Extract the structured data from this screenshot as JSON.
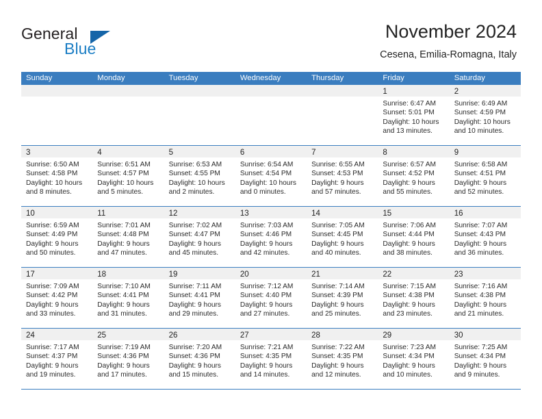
{
  "brand": {
    "name_part1": "General",
    "name_part2": "Blue",
    "flag_color": "#1565a8",
    "blue_color": "#1a7dc4"
  },
  "header": {
    "title": "November 2024",
    "location": "Cesena, Emilia-Romagna, Italy"
  },
  "theme": {
    "header_blue": "#3a7dbf",
    "day_band_gray": "#f0f0f0",
    "text": "#222222"
  },
  "weekdays": [
    "Sunday",
    "Monday",
    "Tuesday",
    "Wednesday",
    "Thursday",
    "Friday",
    "Saturday"
  ],
  "weeks": [
    [
      {
        "day": "",
        "sunrise": "",
        "sunset": "",
        "daylight_line1": "",
        "daylight_line2": "",
        "empty": true
      },
      {
        "day": "",
        "sunrise": "",
        "sunset": "",
        "daylight_line1": "",
        "daylight_line2": "",
        "empty": true
      },
      {
        "day": "",
        "sunrise": "",
        "sunset": "",
        "daylight_line1": "",
        "daylight_line2": "",
        "empty": true
      },
      {
        "day": "",
        "sunrise": "",
        "sunset": "",
        "daylight_line1": "",
        "daylight_line2": "",
        "empty": true
      },
      {
        "day": "",
        "sunrise": "",
        "sunset": "",
        "daylight_line1": "",
        "daylight_line2": "",
        "empty": true
      },
      {
        "day": "1",
        "sunrise": "Sunrise: 6:47 AM",
        "sunset": "Sunset: 5:01 PM",
        "daylight_line1": "Daylight: 10 hours",
        "daylight_line2": "and 13 minutes."
      },
      {
        "day": "2",
        "sunrise": "Sunrise: 6:49 AM",
        "sunset": "Sunset: 4:59 PM",
        "daylight_line1": "Daylight: 10 hours",
        "daylight_line2": "and 10 minutes."
      }
    ],
    [
      {
        "day": "3",
        "sunrise": "Sunrise: 6:50 AM",
        "sunset": "Sunset: 4:58 PM",
        "daylight_line1": "Daylight: 10 hours",
        "daylight_line2": "and 8 minutes."
      },
      {
        "day": "4",
        "sunrise": "Sunrise: 6:51 AM",
        "sunset": "Sunset: 4:57 PM",
        "daylight_line1": "Daylight: 10 hours",
        "daylight_line2": "and 5 minutes."
      },
      {
        "day": "5",
        "sunrise": "Sunrise: 6:53 AM",
        "sunset": "Sunset: 4:55 PM",
        "daylight_line1": "Daylight: 10 hours",
        "daylight_line2": "and 2 minutes."
      },
      {
        "day": "6",
        "sunrise": "Sunrise: 6:54 AM",
        "sunset": "Sunset: 4:54 PM",
        "daylight_line1": "Daylight: 10 hours",
        "daylight_line2": "and 0 minutes."
      },
      {
        "day": "7",
        "sunrise": "Sunrise: 6:55 AM",
        "sunset": "Sunset: 4:53 PM",
        "daylight_line1": "Daylight: 9 hours",
        "daylight_line2": "and 57 minutes."
      },
      {
        "day": "8",
        "sunrise": "Sunrise: 6:57 AM",
        "sunset": "Sunset: 4:52 PM",
        "daylight_line1": "Daylight: 9 hours",
        "daylight_line2": "and 55 minutes."
      },
      {
        "day": "9",
        "sunrise": "Sunrise: 6:58 AM",
        "sunset": "Sunset: 4:51 PM",
        "daylight_line1": "Daylight: 9 hours",
        "daylight_line2": "and 52 minutes."
      }
    ],
    [
      {
        "day": "10",
        "sunrise": "Sunrise: 6:59 AM",
        "sunset": "Sunset: 4:49 PM",
        "daylight_line1": "Daylight: 9 hours",
        "daylight_line2": "and 50 minutes."
      },
      {
        "day": "11",
        "sunrise": "Sunrise: 7:01 AM",
        "sunset": "Sunset: 4:48 PM",
        "daylight_line1": "Daylight: 9 hours",
        "daylight_line2": "and 47 minutes."
      },
      {
        "day": "12",
        "sunrise": "Sunrise: 7:02 AM",
        "sunset": "Sunset: 4:47 PM",
        "daylight_line1": "Daylight: 9 hours",
        "daylight_line2": "and 45 minutes."
      },
      {
        "day": "13",
        "sunrise": "Sunrise: 7:03 AM",
        "sunset": "Sunset: 4:46 PM",
        "daylight_line1": "Daylight: 9 hours",
        "daylight_line2": "and 42 minutes."
      },
      {
        "day": "14",
        "sunrise": "Sunrise: 7:05 AM",
        "sunset": "Sunset: 4:45 PM",
        "daylight_line1": "Daylight: 9 hours",
        "daylight_line2": "and 40 minutes."
      },
      {
        "day": "15",
        "sunrise": "Sunrise: 7:06 AM",
        "sunset": "Sunset: 4:44 PM",
        "daylight_line1": "Daylight: 9 hours",
        "daylight_line2": "and 38 minutes."
      },
      {
        "day": "16",
        "sunrise": "Sunrise: 7:07 AM",
        "sunset": "Sunset: 4:43 PM",
        "daylight_line1": "Daylight: 9 hours",
        "daylight_line2": "and 36 minutes."
      }
    ],
    [
      {
        "day": "17",
        "sunrise": "Sunrise: 7:09 AM",
        "sunset": "Sunset: 4:42 PM",
        "daylight_line1": "Daylight: 9 hours",
        "daylight_line2": "and 33 minutes."
      },
      {
        "day": "18",
        "sunrise": "Sunrise: 7:10 AM",
        "sunset": "Sunset: 4:41 PM",
        "daylight_line1": "Daylight: 9 hours",
        "daylight_line2": "and 31 minutes."
      },
      {
        "day": "19",
        "sunrise": "Sunrise: 7:11 AM",
        "sunset": "Sunset: 4:41 PM",
        "daylight_line1": "Daylight: 9 hours",
        "daylight_line2": "and 29 minutes."
      },
      {
        "day": "20",
        "sunrise": "Sunrise: 7:12 AM",
        "sunset": "Sunset: 4:40 PM",
        "daylight_line1": "Daylight: 9 hours",
        "daylight_line2": "and 27 minutes."
      },
      {
        "day": "21",
        "sunrise": "Sunrise: 7:14 AM",
        "sunset": "Sunset: 4:39 PM",
        "daylight_line1": "Daylight: 9 hours",
        "daylight_line2": "and 25 minutes."
      },
      {
        "day": "22",
        "sunrise": "Sunrise: 7:15 AM",
        "sunset": "Sunset: 4:38 PM",
        "daylight_line1": "Daylight: 9 hours",
        "daylight_line2": "and 23 minutes."
      },
      {
        "day": "23",
        "sunrise": "Sunrise: 7:16 AM",
        "sunset": "Sunset: 4:38 PM",
        "daylight_line1": "Daylight: 9 hours",
        "daylight_line2": "and 21 minutes."
      }
    ],
    [
      {
        "day": "24",
        "sunrise": "Sunrise: 7:17 AM",
        "sunset": "Sunset: 4:37 PM",
        "daylight_line1": "Daylight: 9 hours",
        "daylight_line2": "and 19 minutes."
      },
      {
        "day": "25",
        "sunrise": "Sunrise: 7:19 AM",
        "sunset": "Sunset: 4:36 PM",
        "daylight_line1": "Daylight: 9 hours",
        "daylight_line2": "and 17 minutes."
      },
      {
        "day": "26",
        "sunrise": "Sunrise: 7:20 AM",
        "sunset": "Sunset: 4:36 PM",
        "daylight_line1": "Daylight: 9 hours",
        "daylight_line2": "and 15 minutes."
      },
      {
        "day": "27",
        "sunrise": "Sunrise: 7:21 AM",
        "sunset": "Sunset: 4:35 PM",
        "daylight_line1": "Daylight: 9 hours",
        "daylight_line2": "and 14 minutes."
      },
      {
        "day": "28",
        "sunrise": "Sunrise: 7:22 AM",
        "sunset": "Sunset: 4:35 PM",
        "daylight_line1": "Daylight: 9 hours",
        "daylight_line2": "and 12 minutes."
      },
      {
        "day": "29",
        "sunrise": "Sunrise: 7:23 AM",
        "sunset": "Sunset: 4:34 PM",
        "daylight_line1": "Daylight: 9 hours",
        "daylight_line2": "and 10 minutes."
      },
      {
        "day": "30",
        "sunrise": "Sunrise: 7:25 AM",
        "sunset": "Sunset: 4:34 PM",
        "daylight_line1": "Daylight: 9 hours",
        "daylight_line2": "and 9 minutes."
      }
    ]
  ]
}
